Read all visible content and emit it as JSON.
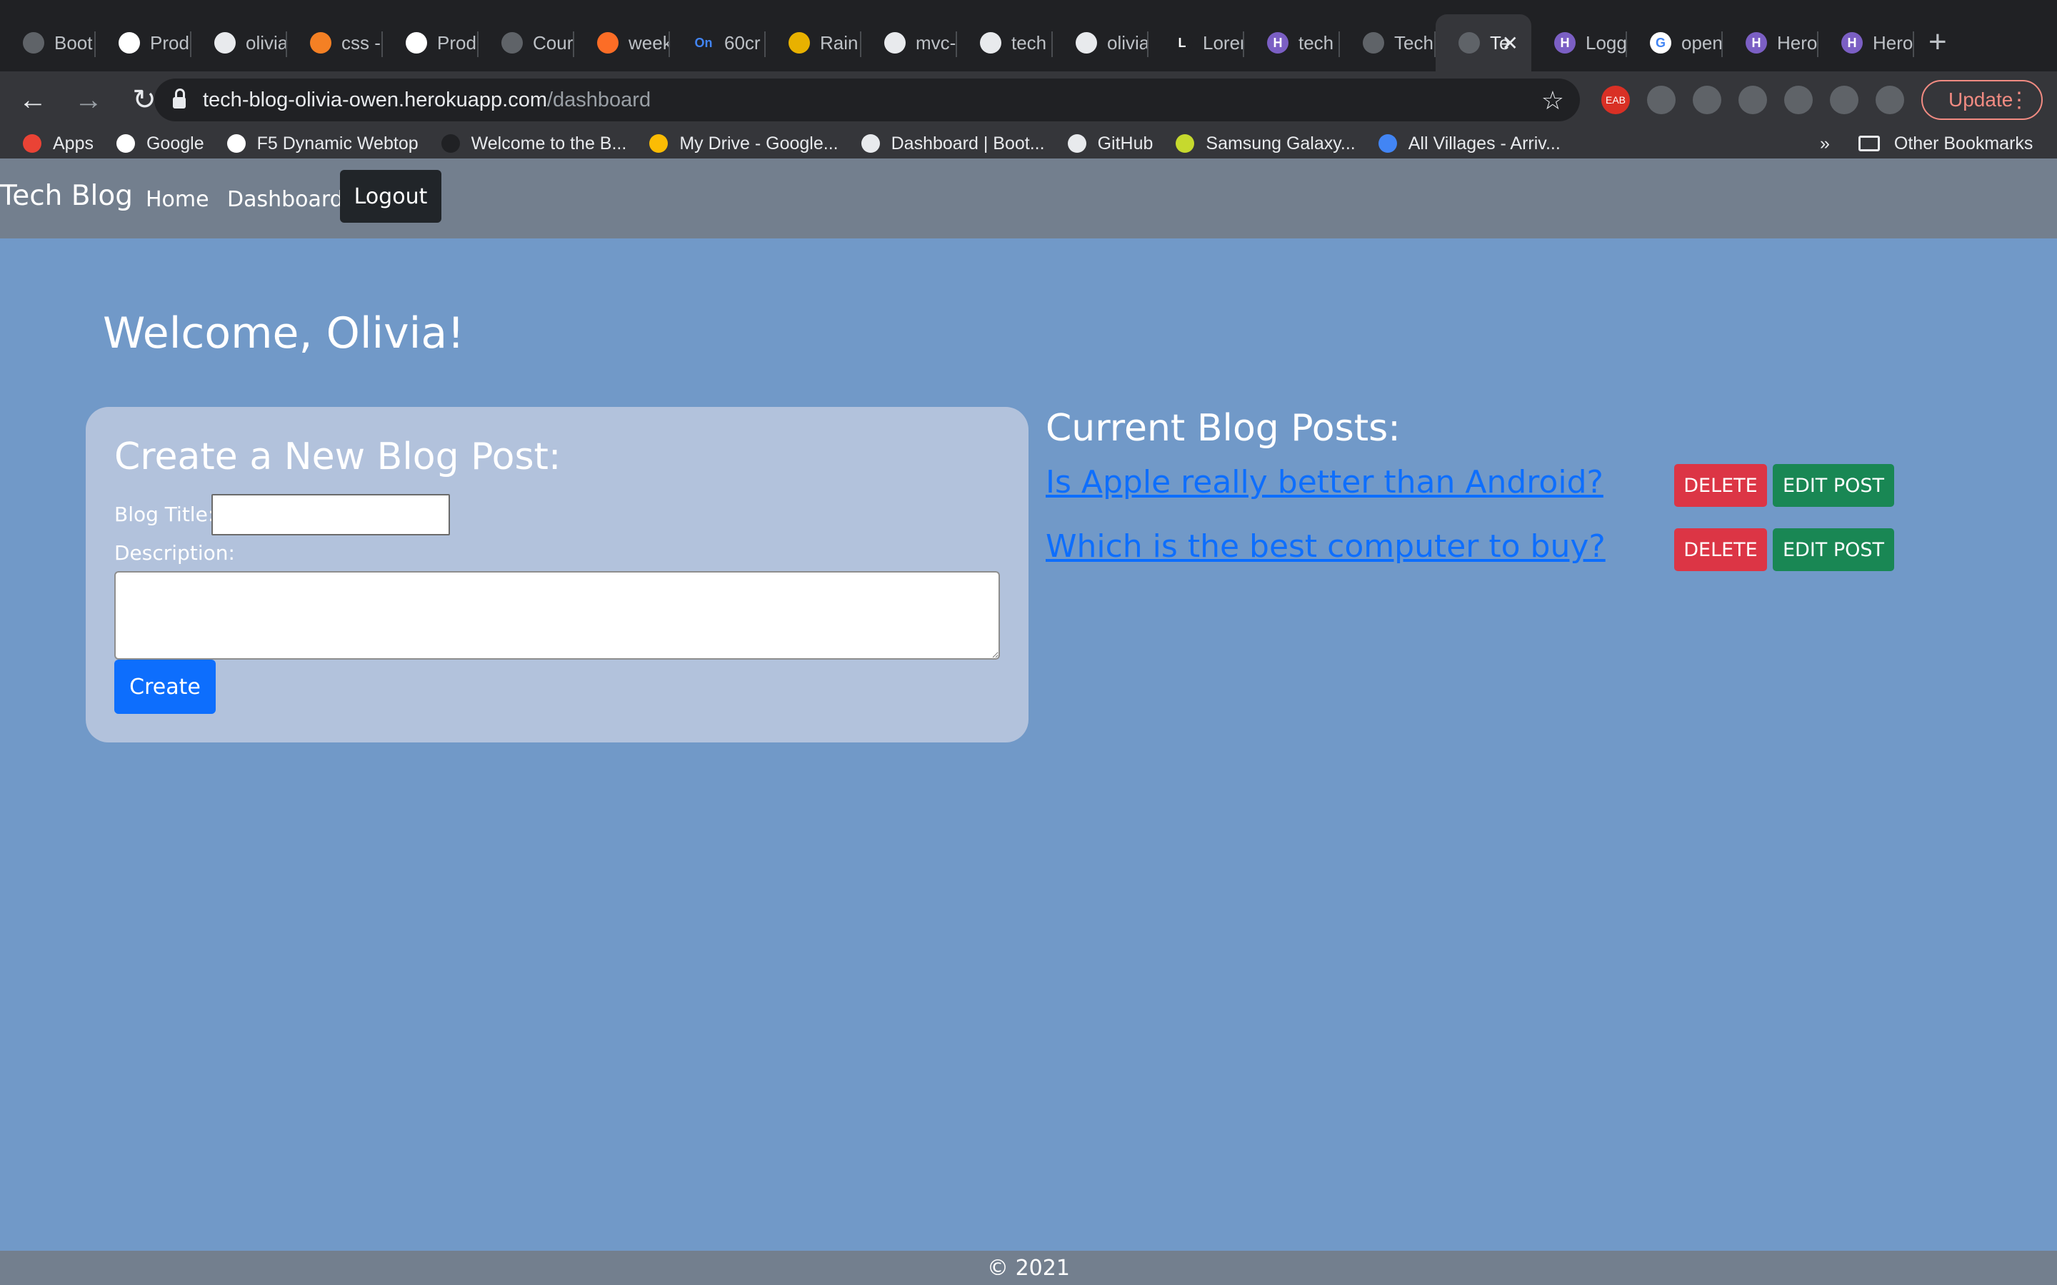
{
  "browser": {
    "tabs": [
      {
        "title": "Boot",
        "icon": "globe-icon",
        "color": "#5f6368",
        "glyph": ""
      },
      {
        "title": "Prod",
        "icon": "page-icon",
        "color": "#ffffff",
        "glyph": ""
      },
      {
        "title": "olivia",
        "icon": "github-icon",
        "color": "#e8eaed",
        "glyph": ""
      },
      {
        "title": "css -",
        "icon": "stackoverflow-icon",
        "color": "#f48024",
        "glyph": ""
      },
      {
        "title": "Prod",
        "icon": "page-icon",
        "color": "#ffffff",
        "glyph": ""
      },
      {
        "title": "Cour",
        "icon": "globe-icon",
        "color": "#5f6368",
        "glyph": ""
      },
      {
        "title": "week",
        "icon": "gitlab-icon",
        "color": "#fc6d26",
        "glyph": ""
      },
      {
        "title": "60cr",
        "icon": "on-icon",
        "color": "#202124",
        "glyph": "On"
      },
      {
        "title": "Rain",
        "icon": "bars-icon",
        "color": "#e8b100",
        "glyph": ""
      },
      {
        "title": "mvc-",
        "icon": "github-icon",
        "color": "#e8eaed",
        "glyph": ""
      },
      {
        "title": "tech",
        "icon": "github-icon",
        "color": "#e8eaed",
        "glyph": ""
      },
      {
        "title": "olivia",
        "icon": "github-icon",
        "color": "#e8eaed",
        "glyph": ""
      },
      {
        "title": "Lorem",
        "icon": "lorem-icon",
        "color": "#202124",
        "glyph": "L"
      },
      {
        "title": "tech",
        "icon": "heroku-icon",
        "color": "#7b5fc4",
        "glyph": "H"
      },
      {
        "title": "Tech",
        "icon": "globe-icon",
        "color": "#5f6368",
        "glyph": ""
      },
      {
        "title": "Te",
        "icon": "globe-icon",
        "color": "#5f6368",
        "glyph": "",
        "active": true
      },
      {
        "title": "Logg",
        "icon": "heroku-icon",
        "color": "#7b5fc4",
        "glyph": "H"
      },
      {
        "title": "open",
        "icon": "google-icon",
        "color": "#ffffff",
        "glyph": "G"
      },
      {
        "title": "Hero",
        "icon": "heroku-icon",
        "color": "#7b5fc4",
        "glyph": "H"
      },
      {
        "title": "Hero",
        "icon": "heroku-icon",
        "color": "#7b5fc4",
        "glyph": "H"
      }
    ],
    "url_host": "tech-blog-olivia-owen.herokuapp.com",
    "url_path": "/dashboard",
    "update_label": "Update",
    "ext_labels": [
      "EAB",
      "",
      "",
      "",
      "",
      ""
    ],
    "bookmarks": [
      {
        "label": "Apps",
        "icon": "apps-grid-icon",
        "color": "#ea4335"
      },
      {
        "label": "Google",
        "icon": "google-icon",
        "color": "#ffffff"
      },
      {
        "label": "F5 Dynamic Webtop",
        "icon": "page-icon",
        "color": "#ffffff"
      },
      {
        "label": "Welcome to the B...",
        "icon": "book-icon",
        "color": "#202124"
      },
      {
        "label": "My Drive - Google...",
        "icon": "drive-icon",
        "color": "#fbbc04"
      },
      {
        "label": "Dashboard | Boot...",
        "icon": "globe-icon",
        "color": "#e8eaed"
      },
      {
        "label": "GitHub",
        "icon": "github-icon",
        "color": "#e8eaed"
      },
      {
        "label": "Samsung Galaxy...",
        "icon": "samsung-icon",
        "color": "#c6d92e"
      },
      {
        "label": "All Villages - Arriv...",
        "icon": "star-icon",
        "color": "#4285f4"
      }
    ],
    "more_bookmarks": "»",
    "other_bookmarks": "Other Bookmarks"
  },
  "site": {
    "brand": "Tech Blog",
    "nav_home": "Home",
    "nav_dashboard": "Dashboard",
    "logout": "Logout"
  },
  "main": {
    "welcome": "Welcome, Olivia!",
    "form": {
      "title": "Create a New Blog Post:",
      "blog_title_label": "Blog Title:",
      "blog_title_value": "",
      "description_label": "Description:",
      "description_value": "",
      "create_label": "Create"
    },
    "posts_title": "Current Blog Posts:",
    "posts": [
      {
        "title": "Is Apple really better than Android?",
        "delete": "DELETE",
        "edit": "EDIT POST"
      },
      {
        "title": "Which is the best computer to buy?",
        "delete": "DELETE",
        "edit": "EDIT POST"
      }
    ]
  },
  "footer": {
    "text": "© 2021"
  }
}
